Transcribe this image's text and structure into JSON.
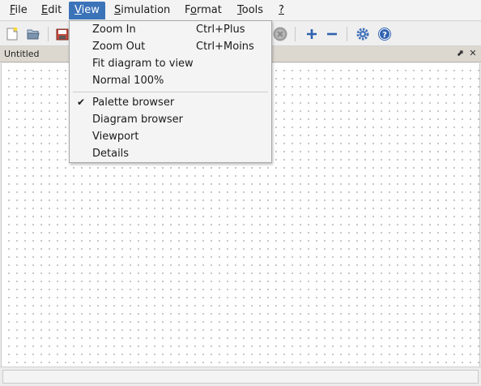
{
  "menubar": {
    "items": [
      {
        "label": "File",
        "mnemonic": "F",
        "rest": "ile"
      },
      {
        "label": "Edit",
        "mnemonic": "E",
        "rest": "dit"
      },
      {
        "label": "View",
        "mnemonic": "V",
        "rest": "iew"
      },
      {
        "label": "Simulation",
        "mnemonic": "S",
        "rest": "imulation"
      },
      {
        "label": "Format",
        "mnemonic": "o",
        "pre": "F",
        "rest": "rmat"
      },
      {
        "label": "Tools",
        "mnemonic": "T",
        "rest": "ools"
      },
      {
        "label": "?",
        "mnemonic": "?",
        "rest": ""
      }
    ],
    "active": "View"
  },
  "toolbar": {
    "icons": [
      "new-file-icon",
      "open-folder-icon",
      "save-icon",
      "stop-icon",
      "zoom-in-icon",
      "zoom-out-icon",
      "settings-icon",
      "help-icon"
    ]
  },
  "document": {
    "title": "Untitled",
    "undock_symbol": "⬈",
    "close_symbol": "✕"
  },
  "view_menu": {
    "items": [
      {
        "label": "Zoom In",
        "shortcut": "Ctrl+Plus",
        "checked": false
      },
      {
        "label": "Zoom Out",
        "shortcut": "Ctrl+Moins",
        "checked": false
      },
      {
        "label": "Fit diagram to view",
        "shortcut": "",
        "checked": false
      },
      {
        "label": "Normal 100%",
        "shortcut": "",
        "checked": false
      },
      {
        "label": "Palette browser",
        "shortcut": "",
        "checked": true
      },
      {
        "label": "Diagram browser",
        "shortcut": "",
        "checked": false
      },
      {
        "label": "Viewport",
        "shortcut": "",
        "checked": false
      },
      {
        "label": "Details",
        "shortcut": "",
        "checked": false
      }
    ],
    "check_symbol": "✔"
  },
  "colors": {
    "menu_highlight": "#3b73b9",
    "icon_blue": "#2f62b0"
  }
}
